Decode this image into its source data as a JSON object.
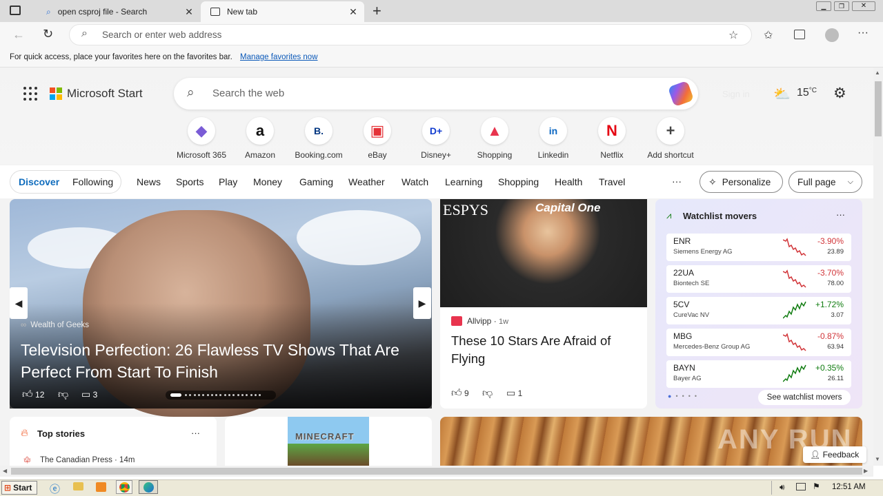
{
  "tabs": [
    {
      "title": "open csproj file - Search"
    },
    {
      "title": "New tab"
    }
  ],
  "address": {
    "placeholder": "Search or enter web address"
  },
  "favorites_bar": {
    "text": "For quick access, place your favorites here on the favorites bar.",
    "link": "Manage favorites now"
  },
  "header": {
    "brand": "Microsoft Start",
    "search_placeholder": "Search the web",
    "sign_in": "Sign in",
    "temperature": "15",
    "temp_unit": "°C"
  },
  "shortcuts": [
    {
      "label": "Microsoft 365",
      "icon": "microsoft365-icon",
      "glyph": "◆",
      "color": "#7a5cd6"
    },
    {
      "label": "Amazon",
      "icon": "amazon-icon",
      "glyph": "a",
      "color": "#111111"
    },
    {
      "label": "Booking.com",
      "icon": "booking-icon",
      "glyph": "B.",
      "color": "#003580"
    },
    {
      "label": "eBay",
      "icon": "ebay-icon",
      "glyph": "▣",
      "color": "#e53238"
    },
    {
      "label": "Disney+",
      "icon": "disney-icon",
      "glyph": "D+",
      "color": "#113ccf"
    },
    {
      "label": "Shopping",
      "icon": "shopping-icon",
      "glyph": "▲",
      "color": "#e8344e"
    },
    {
      "label": "Linkedin",
      "icon": "linkedin-icon",
      "glyph": "in",
      "color": "#0a66c2"
    },
    {
      "label": "Netflix",
      "icon": "netflix-icon",
      "glyph": "N",
      "color": "#e50914"
    },
    {
      "label": "Add shortcut",
      "icon": "plus-icon",
      "glyph": "+",
      "color": "#444444"
    }
  ],
  "nav": {
    "tabs": [
      "Discover",
      "Following"
    ],
    "items": [
      "News",
      "Sports",
      "Play",
      "Money",
      "Gaming",
      "Weather",
      "Watch",
      "Learning",
      "Shopping",
      "Health",
      "Travel"
    ],
    "more": "···",
    "personalize": "Personalize",
    "full_page": "Full page"
  },
  "hero": {
    "source": "Wealth of Geeks",
    "headline_line1": "Television Perfection: 26 Flawless TV Shows That Are",
    "headline_line2": "Perfect From Start To Finish",
    "likes": "12",
    "comments": "3"
  },
  "card2": {
    "source": "Allvipp",
    "age": "1w",
    "headline_line1": "These 10 Stars Are Afraid of",
    "headline_line2": "Flying",
    "likes": "9",
    "comments": "1",
    "sign1": "ESPYS",
    "sign2": "Capital One"
  },
  "watchlist": {
    "title": "Watchlist movers",
    "footer": "See watchlist movers",
    "colors": {
      "down": "#d13438",
      "up": "#107c10"
    },
    "items": [
      {
        "symbol": "ENR",
        "name": "Siemens Energy AG",
        "change": "-3.90%",
        "price": "23.89",
        "dir": "down"
      },
      {
        "symbol": "22UA",
        "name": "Biontech SE",
        "change": "-3.70%",
        "price": "78.00",
        "dir": "down"
      },
      {
        "symbol": "5CV",
        "name": "CureVac NV",
        "change": "+1.72%",
        "price": "3.07",
        "dir": "up"
      },
      {
        "symbol": "MBG",
        "name": "Mercedes-Benz Group AG",
        "change": "-0.87%",
        "price": "63.94",
        "dir": "down"
      },
      {
        "symbol": "BAYN",
        "name": "Bayer AG",
        "change": "+0.35%",
        "price": "26.11",
        "dir": "up"
      }
    ]
  },
  "top_stories": {
    "title": "Top stories",
    "source": "The Canadian Press · 14m",
    "more": "···"
  },
  "minecraft": "MINECRAFT",
  "feedback": "Feedback",
  "watermark": "ANY RUN",
  "taskbar": {
    "start": "Start",
    "time": "12:51 AM"
  }
}
